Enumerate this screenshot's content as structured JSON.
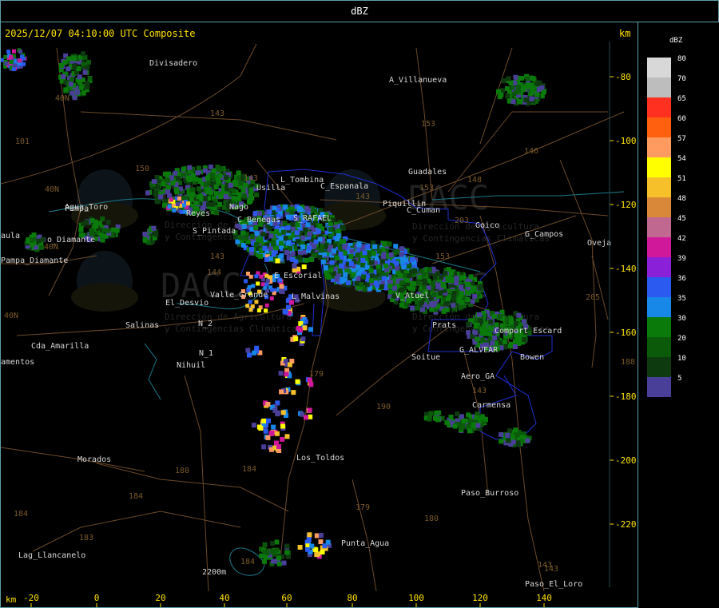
{
  "window": {
    "title": "dBZ"
  },
  "map": {
    "header": "2025/12/07 04:10:00 UTC Composite",
    "unit_top": "km",
    "unit_bottom": "km",
    "x_ticks": [
      {
        "label": "-20"
      },
      {
        "label": "0"
      },
      {
        "label": "20"
      },
      {
        "label": "40"
      },
      {
        "label": "60"
      },
      {
        "label": "80"
      },
      {
        "label": "100"
      },
      {
        "label": "120"
      },
      {
        "label": "140"
      }
    ],
    "y_ticks": [
      {
        "label": "-80"
      },
      {
        "label": "-100"
      },
      {
        "label": "-120"
      },
      {
        "label": "-140"
      },
      {
        "label": "-160"
      },
      {
        "label": "-180"
      },
      {
        "label": "-200"
      },
      {
        "label": "-220"
      }
    ],
    "places": [
      {
        "name": "Divisadero"
      },
      {
        "name": "A_Villanueva"
      },
      {
        "name": "Guadales"
      },
      {
        "name": "L_Tombina"
      },
      {
        "name": "Usilla"
      },
      {
        "name": "C_Espanala"
      },
      {
        "name": "Piquillin"
      },
      {
        "name": "C_Cuman"
      },
      {
        "name": "Goico"
      },
      {
        "name": "G_Campos"
      },
      {
        "name": "Oveja"
      },
      {
        "name": "Agua_Toro"
      },
      {
        "name": "Reyes"
      },
      {
        "name": "Nago"
      },
      {
        "name": "C_Benegas"
      },
      {
        "name": "S_RAFAEL"
      },
      {
        "name": "S_Pintada"
      },
      {
        "name": "aula"
      },
      {
        "name": "o_Diamante"
      },
      {
        "name": "Pampa_Diamante"
      },
      {
        "name": "E_Escorial"
      },
      {
        "name": "El_Desvio"
      },
      {
        "name": "Valle_Grande"
      },
      {
        "name": "L_Malvinas"
      },
      {
        "name": "V_Atuel"
      },
      {
        "name": "Salinas"
      },
      {
        "name": "N_2"
      },
      {
        "name": "Cda_Amarilla"
      },
      {
        "name": "N_1"
      },
      {
        "name": "Nihuil"
      },
      {
        "name": "amentos"
      },
      {
        "name": "Prats"
      },
      {
        "name": "Comport Escard"
      },
      {
        "name": "Bowen"
      },
      {
        "name": "G_ALVEAR"
      },
      {
        "name": "Soitue"
      },
      {
        "name": "Aero_GA"
      },
      {
        "name": "Carmensa"
      },
      {
        "name": "Morados"
      },
      {
        "name": "Los_Toldos"
      },
      {
        "name": "Paso_Burroso"
      },
      {
        "name": "Punta_Agua"
      },
      {
        "name": "Lag_Llancanelo"
      },
      {
        "name": "Paso_El_Loro"
      },
      {
        "name": "2200m"
      },
      {
        "name": "Pampa"
      }
    ],
    "route_labels": [
      {
        "label": "143"
      },
      {
        "label": "153"
      },
      {
        "label": "146"
      },
      {
        "label": "101"
      },
      {
        "label": "40N"
      },
      {
        "label": "150"
      },
      {
        "label": "143"
      },
      {
        "label": "40N"
      },
      {
        "label": "143"
      },
      {
        "label": "203"
      },
      {
        "label": "148"
      },
      {
        "label": "153"
      },
      {
        "label": "40N"
      },
      {
        "label": "40N"
      },
      {
        "label": "143"
      },
      {
        "label": "144"
      },
      {
        "label": "153"
      },
      {
        "label": "205"
      },
      {
        "label": "188"
      },
      {
        "label": "180"
      },
      {
        "label": "184"
      },
      {
        "label": "179"
      },
      {
        "label": "184"
      },
      {
        "label": "180"
      },
      {
        "label": "184"
      },
      {
        "label": "179"
      },
      {
        "label": "190"
      },
      {
        "label": "183"
      },
      {
        "label": "143"
      },
      {
        "label": "143"
      },
      {
        "label": "184"
      },
      {
        "label": "143"
      }
    ],
    "watermark": {
      "brand": "DACC",
      "line1": "Dirección de Agricultura",
      "line2": "y Contingencias Climáticas"
    }
  },
  "legend": {
    "title": "dBZ",
    "items": [
      {
        "value": "80",
        "color": "#d8d8d8"
      },
      {
        "value": "70",
        "color": "#bdbdbd"
      },
      {
        "value": "65",
        "color": "#ff3020"
      },
      {
        "value": "60",
        "color": "#ff6010"
      },
      {
        "value": "57",
        "color": "#ff9a60"
      },
      {
        "value": "54",
        "color": "#ffff00"
      },
      {
        "value": "51",
        "color": "#f6c02a"
      },
      {
        "value": "48",
        "color": "#d88838"
      },
      {
        "value": "45",
        "color": "#c06890"
      },
      {
        "value": "42",
        "color": "#d0189a"
      },
      {
        "value": "39",
        "color": "#8a20d8"
      },
      {
        "value": "36",
        "color": "#2a5af0"
      },
      {
        "value": "35",
        "color": "#1888e8"
      },
      {
        "value": "30",
        "color": "#0a7a0a"
      },
      {
        "value": "20",
        "color": "#0a5a0a"
      },
      {
        "value": "10",
        "color": "#0e3a10"
      },
      {
        "value": "5",
        "color": "#4a3f98"
      }
    ]
  },
  "colors": {
    "frame": "#5fa0a8",
    "ticks": "#ffe300",
    "roads": "#6b4a2a",
    "routes": "#7a5a2a",
    "provinces": "#1f2fd0",
    "rivers": "#1c7a8a"
  }
}
